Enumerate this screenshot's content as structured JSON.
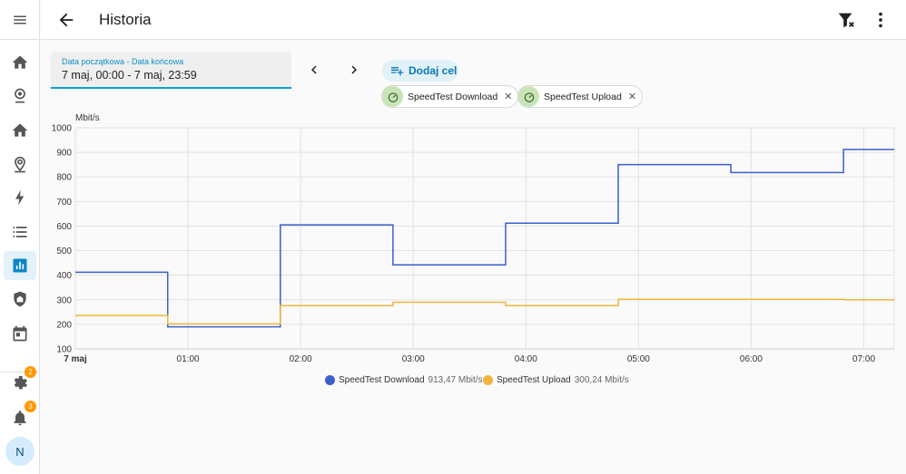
{
  "header": {
    "title": "Historia"
  },
  "date_field": {
    "label": "Data początkowa - Data końcowa",
    "value": "7 maj, 00:00 - 7 maj, 23:59"
  },
  "add_target": {
    "label": "Dodaj cel"
  },
  "chips": [
    {
      "label": "SpeedTest Download"
    },
    {
      "label": "SpeedTest Upload"
    }
  ],
  "sidebar": {
    "items": [
      {
        "icon": "home-icon"
      },
      {
        "icon": "webcam-icon"
      },
      {
        "icon": "home-icon"
      },
      {
        "icon": "map-marker-icon"
      },
      {
        "icon": "lightning-icon"
      },
      {
        "icon": "list-icon"
      },
      {
        "icon": "chart-box-icon"
      },
      {
        "icon": "shield-icon"
      },
      {
        "icon": "calendar-icon"
      }
    ],
    "settings_badge": "2",
    "notifications_badge": "3",
    "avatar": "N"
  },
  "chart_data": {
    "type": "line",
    "ylabel": "Mbit/s",
    "ylim": [
      100,
      1000
    ],
    "yticks": [
      "100",
      "200",
      "300",
      "400",
      "500",
      "600",
      "700",
      "800",
      "900",
      "1000"
    ],
    "xticks": [
      "7 maj",
      "01:00",
      "02:00",
      "03:00",
      "04:00",
      "05:00",
      "06:00",
      "07:00"
    ],
    "grid": true,
    "step": true,
    "series": [
      {
        "name": "SpeedTest Download",
        "color": "#3a5fcd",
        "state": "913,47 Mbit/s",
        "points": [
          [
            0,
            412
          ],
          [
            0.82,
            190
          ],
          [
            1.82,
            605
          ],
          [
            2.82,
            442
          ],
          [
            3.82,
            612
          ],
          [
            4.82,
            850
          ],
          [
            5.82,
            818
          ],
          [
            6.82,
            912
          ],
          [
            7.45,
            912
          ]
        ]
      },
      {
        "name": "SpeedTest Upload",
        "color": "#f0b53a",
        "state": "300,24 Mbit/s",
        "points": [
          [
            0,
            236
          ],
          [
            0.82,
            202
          ],
          [
            1.82,
            276
          ],
          [
            2.82,
            290
          ],
          [
            3.82,
            276
          ],
          [
            4.82,
            302
          ],
          [
            5.82,
            302
          ],
          [
            6.82,
            300
          ],
          [
            7.45,
            300
          ]
        ]
      }
    ]
  }
}
